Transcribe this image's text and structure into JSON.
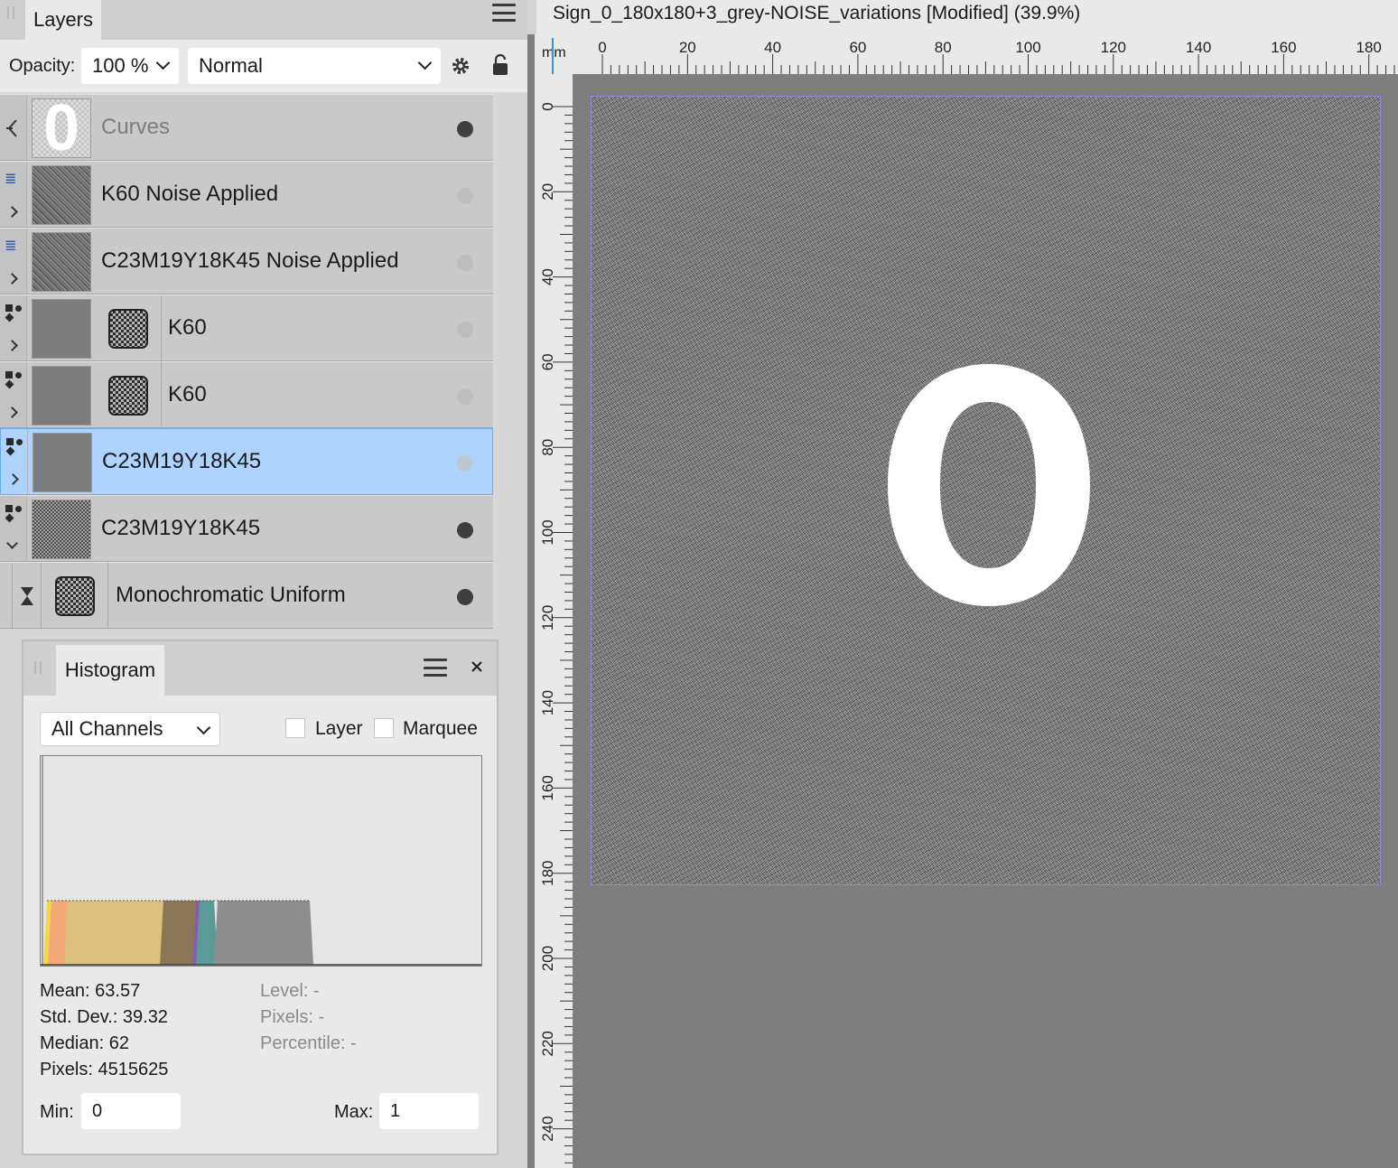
{
  "layers_panel": {
    "tab_label": "Layers",
    "opacity_label": "Opacity:",
    "opacity_value": "100 %",
    "blend_mode": "Normal",
    "layers": [
      {
        "name": "Curves",
        "dimmed": true,
        "visible": true
      },
      {
        "name": "K60 Noise Applied",
        "visible": false
      },
      {
        "name": "C23M19Y18K45 Noise Applied",
        "visible": false
      },
      {
        "name": "K60",
        "visible": false
      },
      {
        "name": "K60",
        "visible": false
      },
      {
        "name": "C23M19Y18K45",
        "selected": true,
        "visible": false
      },
      {
        "name": "C23M19Y18K45",
        "visible": true
      },
      {
        "name": "Monochromatic Uniform",
        "visible": true
      }
    ]
  },
  "histogram": {
    "tab_label": "Histogram",
    "channel": "All Channels",
    "layer_label": "Layer",
    "marquee_label": "Marquee",
    "stats": {
      "mean": "Mean: 63.57",
      "std_dev": "Std. Dev.: 39.32",
      "median": "Median: 62",
      "pixels": "Pixels: 4515625",
      "level": "Level: -",
      "level_pixels": "Pixels: -",
      "percentile": "Percentile: -"
    },
    "min_label": "Min:",
    "min_value": "0",
    "max_label": "Max:",
    "max_value": "1",
    "colors": [
      "#f2d84a",
      "#f5a878",
      "#dcc080",
      "#8a7656",
      "#8b5aa8",
      "#5a9a98",
      "#8e8e8e"
    ]
  },
  "document": {
    "title": "Sign_0_180x180+3_grey-NOISE_variations [Modified] (39.9%)",
    "ruler_unit": "mm",
    "h_ticks": [
      "0",
      "20",
      "40",
      "60",
      "80",
      "100",
      "120",
      "140",
      "160",
      "180"
    ],
    "v_ticks": [
      "0",
      "20",
      "40",
      "60",
      "80",
      "100",
      "120",
      "140",
      "160",
      "180",
      "200",
      "220",
      "240"
    ],
    "canvas_glyph": "0"
  }
}
